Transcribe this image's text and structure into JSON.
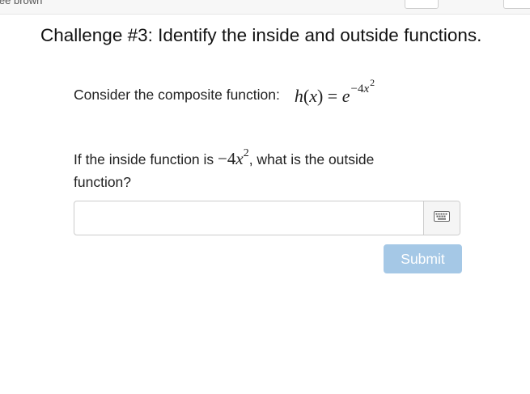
{
  "topbar": {
    "user_name": "lee brown"
  },
  "challenge": {
    "title": "Challenge #3: Identify the inside and outside functions.",
    "prompt_label": "Consider the composite function:",
    "composite": {
      "lhs_fn": "h",
      "lhs_var": "x",
      "equals": "=",
      "base": "e",
      "exp_coeff": "−4",
      "exp_var": "x",
      "exp_power": "2"
    },
    "question_before": "If the inside function is",
    "inside": {
      "coeff": "−4",
      "var": "x",
      "power": "2"
    },
    "question_after": ", what is the outside function?"
  },
  "answer": {
    "value": "",
    "placeholder": "",
    "keyboard_icon": "keyboard-icon"
  },
  "actions": {
    "submit_label": "Submit",
    "submit_color": "#a5c8e6"
  }
}
